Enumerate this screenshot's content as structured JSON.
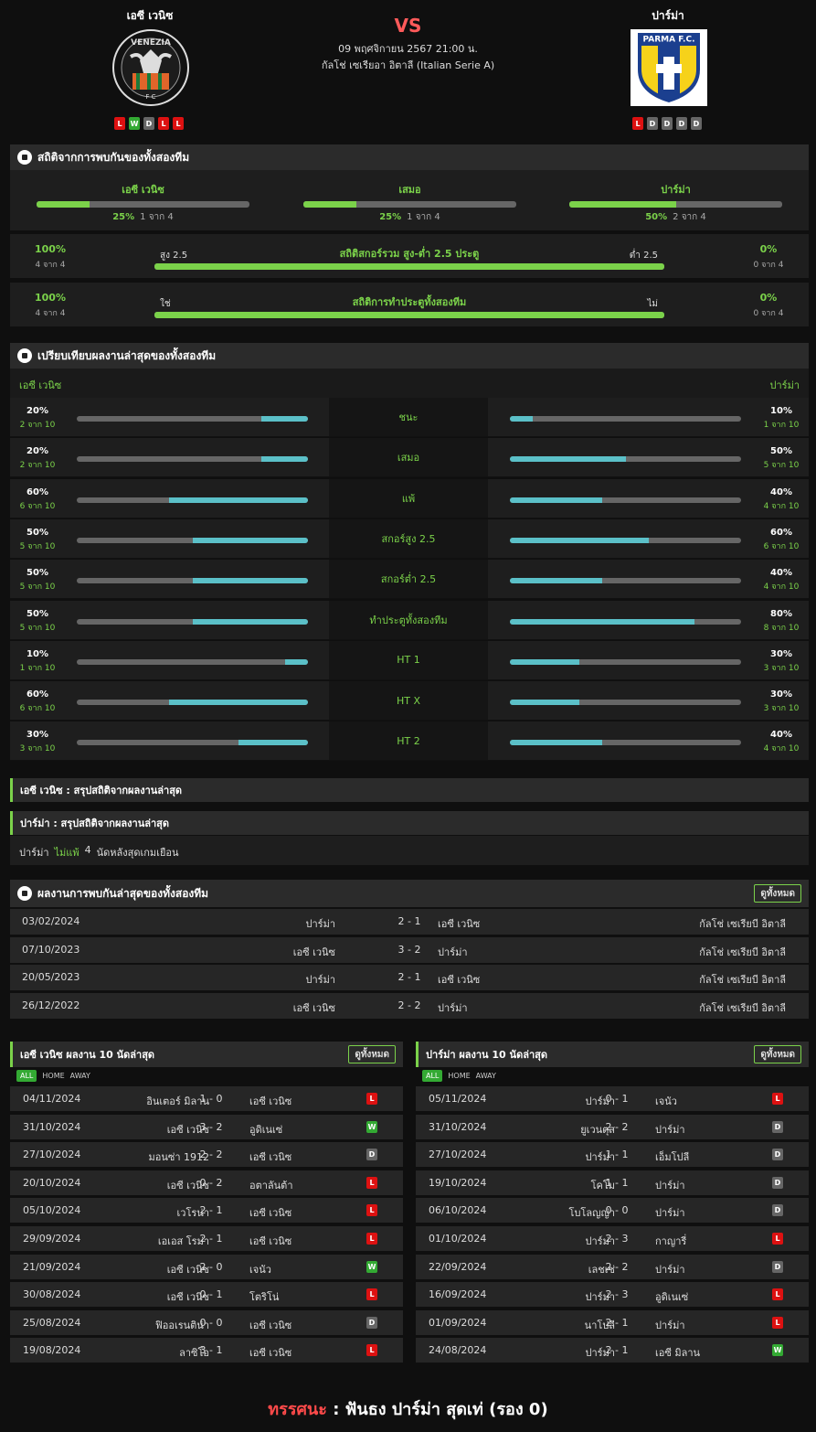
{
  "home": {
    "name": "เอซี เวนิซ",
    "form": [
      "L",
      "W",
      "D",
      "L",
      "L"
    ],
    "logo_text": "VENEZIA",
    "logo_sub": "F C"
  },
  "away": {
    "name": "ปาร์ม่า",
    "form": [
      "L",
      "D",
      "D",
      "D",
      "D"
    ],
    "logo_text": "PARMA F.C."
  },
  "match": {
    "vs": "VS",
    "date": "09 พฤศจิกายน 2567 21:00 น.",
    "league": "กัลโช่ เซเรียอา อิตาลี (Italian Serie A)"
  },
  "h2h": {
    "title": "สถิติจากการพบกันของทั้งสองทีม",
    "items": [
      {
        "label": "เอซี เวนิซ",
        "pct": "25%",
        "of": "1 จาก 4",
        "value": 0.25
      },
      {
        "label": "เสมอ",
        "pct": "25%",
        "of": "1 จาก 4",
        "value": 0.25
      },
      {
        "label": "ปาร์ม่า",
        "pct": "50%",
        "of": "2 จาก 4",
        "value": 0.5
      }
    ],
    "ou": {
      "left_pct": "100%",
      "left_of": "4 จาก 4",
      "left_label": "สูง 2.5",
      "title": "สถิติสกอร์รวม สูง-ต่ำ 2.5 ประตู",
      "right_label": "ต่ำ 2.5",
      "right_pct": "0%",
      "right_of": "0 จาก 4",
      "value": 1.0
    },
    "btts": {
      "left_pct": "100%",
      "left_of": "4 จาก 4",
      "left_label": "ใช่",
      "title": "สถิติการทำประตูทั้งสองทีม",
      "right_label": "ไม่",
      "right_pct": "0%",
      "right_of": "0 จาก 4",
      "value": 1.0
    }
  },
  "compare": {
    "title": "เปรียบเทียบผลงานล่าสุดของทั้งสองทีม",
    "home": "เอซี เวนิซ",
    "away": "ปาร์ม่า",
    "rows": [
      {
        "label": "ชนะ",
        "hp": "20%",
        "hs": "2 จาก 10",
        "hv": 0.2,
        "ap": "10%",
        "as": "1 จาก 10",
        "av": 0.1
      },
      {
        "label": "เสมอ",
        "hp": "20%",
        "hs": "2 จาก 10",
        "hv": 0.2,
        "ap": "50%",
        "as": "5 จาก 10",
        "av": 0.5
      },
      {
        "label": "แพ้",
        "hp": "60%",
        "hs": "6 จาก 10",
        "hv": 0.6,
        "ap": "40%",
        "as": "4 จาก 10",
        "av": 0.4
      },
      {
        "label": "สกอร์สูง 2.5",
        "hp": "50%",
        "hs": "5 จาก 10",
        "hv": 0.5,
        "ap": "60%",
        "as": "6 จาก 10",
        "av": 0.6
      },
      {
        "label": "สกอร์ต่ำ 2.5",
        "hp": "50%",
        "hs": "5 จาก 10",
        "hv": 0.5,
        "ap": "40%",
        "as": "4 จาก 10",
        "av": 0.4
      },
      {
        "label": "ทำประตูทั้งสองทีม",
        "hp": "50%",
        "hs": "5 จาก 10",
        "hv": 0.5,
        "ap": "80%",
        "as": "8 จาก 10",
        "av": 0.8
      },
      {
        "label": "HT 1",
        "hp": "10%",
        "hs": "1 จาก 10",
        "hv": 0.1,
        "ap": "30%",
        "as": "3 จาก 10",
        "av": 0.3
      },
      {
        "label": "HT X",
        "hp": "60%",
        "hs": "6 จาก 10",
        "hv": 0.6,
        "ap": "30%",
        "as": "3 จาก 10",
        "av": 0.3
      },
      {
        "label": "HT 2",
        "hp": "30%",
        "hs": "3 จาก 10",
        "hv": 0.3,
        "ap": "40%",
        "as": "4 จาก 10",
        "av": 0.4
      }
    ]
  },
  "summary": {
    "home_title": "เอซี เวนิซ : สรุปสถิติจากผลงานล่าสุด",
    "away_title": "ปาร์ม่า : สรุปสถิติจากผลงานล่าสุด",
    "away_line": {
      "team": "ปาร์ม่า",
      "tag": "ไม่แพ้",
      "num": "4",
      "text": "นัดหลังสุดเกมเยือน"
    }
  },
  "recent_h2h": {
    "title": "ผลงานการพบกันล่าสุดของทั้งสองทีม",
    "view_all": "ดูทั้งหมด",
    "rows": [
      {
        "date": "03/02/2024",
        "home": "ปาร์ม่า",
        "score": "2 - 1",
        "away": "เอซี เวนิซ",
        "league": "กัลโช่ เซเรียบี อิตาลี"
      },
      {
        "date": "07/10/2023",
        "home": "เอซี เวนิซ",
        "score": "3 - 2",
        "away": "ปาร์ม่า",
        "league": "กัลโช่ เซเรียบี อิตาลี"
      },
      {
        "date": "20/05/2023",
        "home": "ปาร์ม่า",
        "score": "2 - 1",
        "away": "เอซี เวนิซ",
        "league": "กัลโช่ เซเรียบี อิตาลี"
      },
      {
        "date": "26/12/2022",
        "home": "เอซี เวนิซ",
        "score": "2 - 2",
        "away": "ปาร์ม่า",
        "league": "กัลโช่ เซเรียบี อิตาลี"
      }
    ]
  },
  "tabs": [
    "ALL",
    "HOME",
    "AWAY"
  ],
  "home_last": {
    "title": "เอซี เวนิซ ผลงาน 10 นัดล่าสุด",
    "view_all": "ดูทั้งหมด",
    "rows": [
      {
        "date": "04/11/2024",
        "home": "อินเตอร์ มิลาน",
        "score": "1 - 0",
        "away": "เอซี เวนิซ",
        "res": "L"
      },
      {
        "date": "31/10/2024",
        "home": "เอซี เวนิซ",
        "score": "3 - 2",
        "away": "อูดิเนเซ่",
        "res": "W"
      },
      {
        "date": "27/10/2024",
        "home": "มอนซ่า 1912",
        "score": "2 - 2",
        "away": "เอซี เวนิซ",
        "res": "D"
      },
      {
        "date": "20/10/2024",
        "home": "เอซี เวนิซ",
        "score": "0 - 2",
        "away": "อตาลันต้า",
        "res": "L"
      },
      {
        "date": "05/10/2024",
        "home": "เวโรน่า",
        "score": "2 - 1",
        "away": "เอซี เวนิซ",
        "res": "L"
      },
      {
        "date": "29/09/2024",
        "home": "เอเอส โรม่า",
        "score": "2 - 1",
        "away": "เอซี เวนิซ",
        "res": "L"
      },
      {
        "date": "21/09/2024",
        "home": "เอซี เวนิซ",
        "score": "2 - 0",
        "away": "เจนัว",
        "res": "W"
      },
      {
        "date": "30/08/2024",
        "home": "เอซี เวนิซ",
        "score": "0 - 1",
        "away": "โตริโน่",
        "res": "L"
      },
      {
        "date": "25/08/2024",
        "home": "ฟิออเรนติน่า",
        "score": "0 - 0",
        "away": "เอซี เวนิซ",
        "res": "D"
      },
      {
        "date": "19/08/2024",
        "home": "ลาซิโอ",
        "score": "3 - 1",
        "away": "เอซี เวนิซ",
        "res": "L"
      }
    ]
  },
  "away_last": {
    "title": "ปาร์ม่า ผลงาน 10 นัดล่าสุด",
    "view_all": "ดูทั้งหมด",
    "rows": [
      {
        "date": "05/11/2024",
        "home": "ปาร์ม่า",
        "score": "0 - 1",
        "away": "เจนัว",
        "res": "L"
      },
      {
        "date": "31/10/2024",
        "home": "ยูเวนตุส",
        "score": "2 - 2",
        "away": "ปาร์ม่า",
        "res": "D"
      },
      {
        "date": "27/10/2024",
        "home": "ปาร์ม่า",
        "score": "1 - 1",
        "away": "เอ็มโปลี",
        "res": "D"
      },
      {
        "date": "19/10/2024",
        "home": "โคโม",
        "score": "1 - 1",
        "away": "ปาร์ม่า",
        "res": "D"
      },
      {
        "date": "06/10/2024",
        "home": "โบโลญญ่า",
        "score": "0 - 0",
        "away": "ปาร์ม่า",
        "res": "D"
      },
      {
        "date": "01/10/2024",
        "home": "ปาร์ม่า",
        "score": "2 - 3",
        "away": "กาญารี่",
        "res": "L"
      },
      {
        "date": "22/09/2024",
        "home": "เลชเช่",
        "score": "2 - 2",
        "away": "ปาร์ม่า",
        "res": "D"
      },
      {
        "date": "16/09/2024",
        "home": "ปาร์ม่า",
        "score": "2 - 3",
        "away": "อูดิเนเซ่",
        "res": "L"
      },
      {
        "date": "01/09/2024",
        "home": "นาโปลี",
        "score": "2 - 1",
        "away": "ปาร์ม่า",
        "res": "L"
      },
      {
        "date": "24/08/2024",
        "home": "ปาร์ม่า",
        "score": "2 - 1",
        "away": "เอซี มิลาน",
        "res": "W"
      }
    ]
  },
  "verdict": {
    "label": "ทรรศนะ",
    "sep": ":",
    "text": "ฟันธง ปาร์ม่า สุดเท่ (รอง 0)"
  },
  "colors": {
    "accent": "#7bd24a",
    "bar_cyan": "#5bc0c8",
    "loss": "#dd1111",
    "win": "#33aa33",
    "draw": "#666666"
  }
}
